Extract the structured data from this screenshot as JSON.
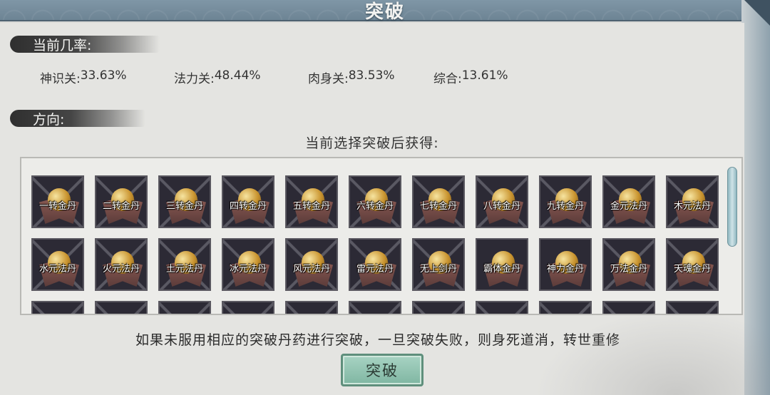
{
  "header": {
    "title": "突破"
  },
  "rates_section": {
    "label": "当前几率:",
    "rates": [
      {
        "label": "神识关:",
        "value": "33.63%"
      },
      {
        "label": "法力关:",
        "value": "48.44%"
      },
      {
        "label": "肉身关:",
        "value": "83.53%"
      },
      {
        "label": "综合:",
        "value": "13.61%"
      }
    ]
  },
  "direction_section": {
    "label": "方向:",
    "subtitle": "当前选择突破后获得:"
  },
  "items": [
    "一转金丹",
    "二转金丹",
    "三转金丹",
    "四转金丹",
    "五转金丹",
    "六转金丹",
    "七转金丹",
    "八转金丹",
    "九转金丹",
    "金元法丹",
    "木元法丹",
    "水元法丹",
    "火元法丹",
    "土元法丹",
    "冰元法丹",
    "风元法丹",
    "雷元法丹",
    "无上剑丹",
    "霸体金丹",
    "神力金丹",
    "万法金丹",
    "天魂金丹"
  ],
  "warning": "如果未服用相应的突破丹药进行突破，一旦突破失败，则身死道消，转世重修",
  "action_button": {
    "label": "突破"
  }
}
